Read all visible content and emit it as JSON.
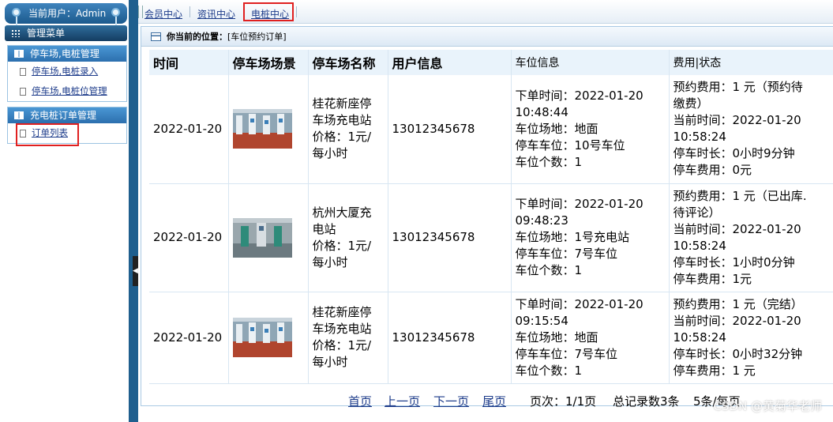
{
  "sidebar": {
    "user_label": "当前用户：Admin",
    "menu_title": "管理菜单",
    "groups": [
      {
        "title": "停车场,电桩管理",
        "items": [
          {
            "label": "停车场,电桩录入"
          },
          {
            "label": "停车场,电桩位管理"
          }
        ]
      },
      {
        "title": "充电桩订单管理",
        "items": [
          {
            "label": "订单列表"
          }
        ]
      }
    ]
  },
  "topnav": {
    "links": [
      {
        "label": "会员中心"
      },
      {
        "label": "资讯中心"
      },
      {
        "label": "电桩中心"
      }
    ]
  },
  "breadcrumb": {
    "prefix": "你当前的位置：",
    "location": "[车位预约订单]"
  },
  "table": {
    "headers": [
      "时间",
      "停车场场景",
      "停车场名称",
      "用户信息",
      "车位信息",
      "费用|状态"
    ],
    "rows": [
      {
        "time": "2022-01-20",
        "name": [
          "桂花新座停",
          "车场充电站",
          "价格：1元/",
          "每小时"
        ],
        "user": "13012345678",
        "space": [
          "下单时间：2022-01-20",
          "10:48:44",
          "车位场地：地面",
          "停车车位：10号车位",
          "车位个数：1"
        ],
        "fee": [
          "预约费用：1 元（预约待",
          "缴费）",
          "当前时间：2022-01-20",
          "10:58:24",
          "停车时长：0小时9分钟",
          "停车费用：0元"
        ]
      },
      {
        "time": "2022-01-20",
        "name": [
          "杭州大厦充",
          "电站",
          "价格：1元/",
          "每小时"
        ],
        "user": "13012345678",
        "space": [
          "下单时间：2022-01-20",
          "09:48:23",
          "车位场地：1号充电站",
          "停车车位：7号车位",
          "车位个数：1"
        ],
        "fee": [
          "预约费用：1 元（已出库.",
          "待评论）",
          "当前时间：2022-01-20",
          "10:58:24",
          "停车时长：1小时0分钟",
          "停车费用：1元"
        ]
      },
      {
        "time": "2022-01-20",
        "name": [
          "桂花新座停",
          "车场充电站",
          "价格：1元/",
          "每小时"
        ],
        "user": "13012345678",
        "space": [
          "下单时间：2022-01-20",
          "09:15:54",
          "车位场地：地面",
          "停车车位：7号车位",
          "车位个数：1"
        ],
        "fee": [
          "预约费用：1 元（完结）",
          "当前时间：2022-01-20",
          "10:58:24",
          "停车时长：0小时32分钟",
          "停车费用：1 元"
        ]
      }
    ]
  },
  "pager": {
    "first": "首页",
    "prev": "上一页",
    "next": "下一页",
    "last": "尾页",
    "page_info": "页次：1/1页",
    "total": "总记录数3条",
    "per_page": "5条/每页"
  },
  "watermark": "CSDN @黄菊华老师",
  "colors": {
    "sidebar_blue": "#1f5f8e",
    "link": "#1c3b8a",
    "highlight": "#e02020",
    "header_bg": "#e9f3fb"
  }
}
